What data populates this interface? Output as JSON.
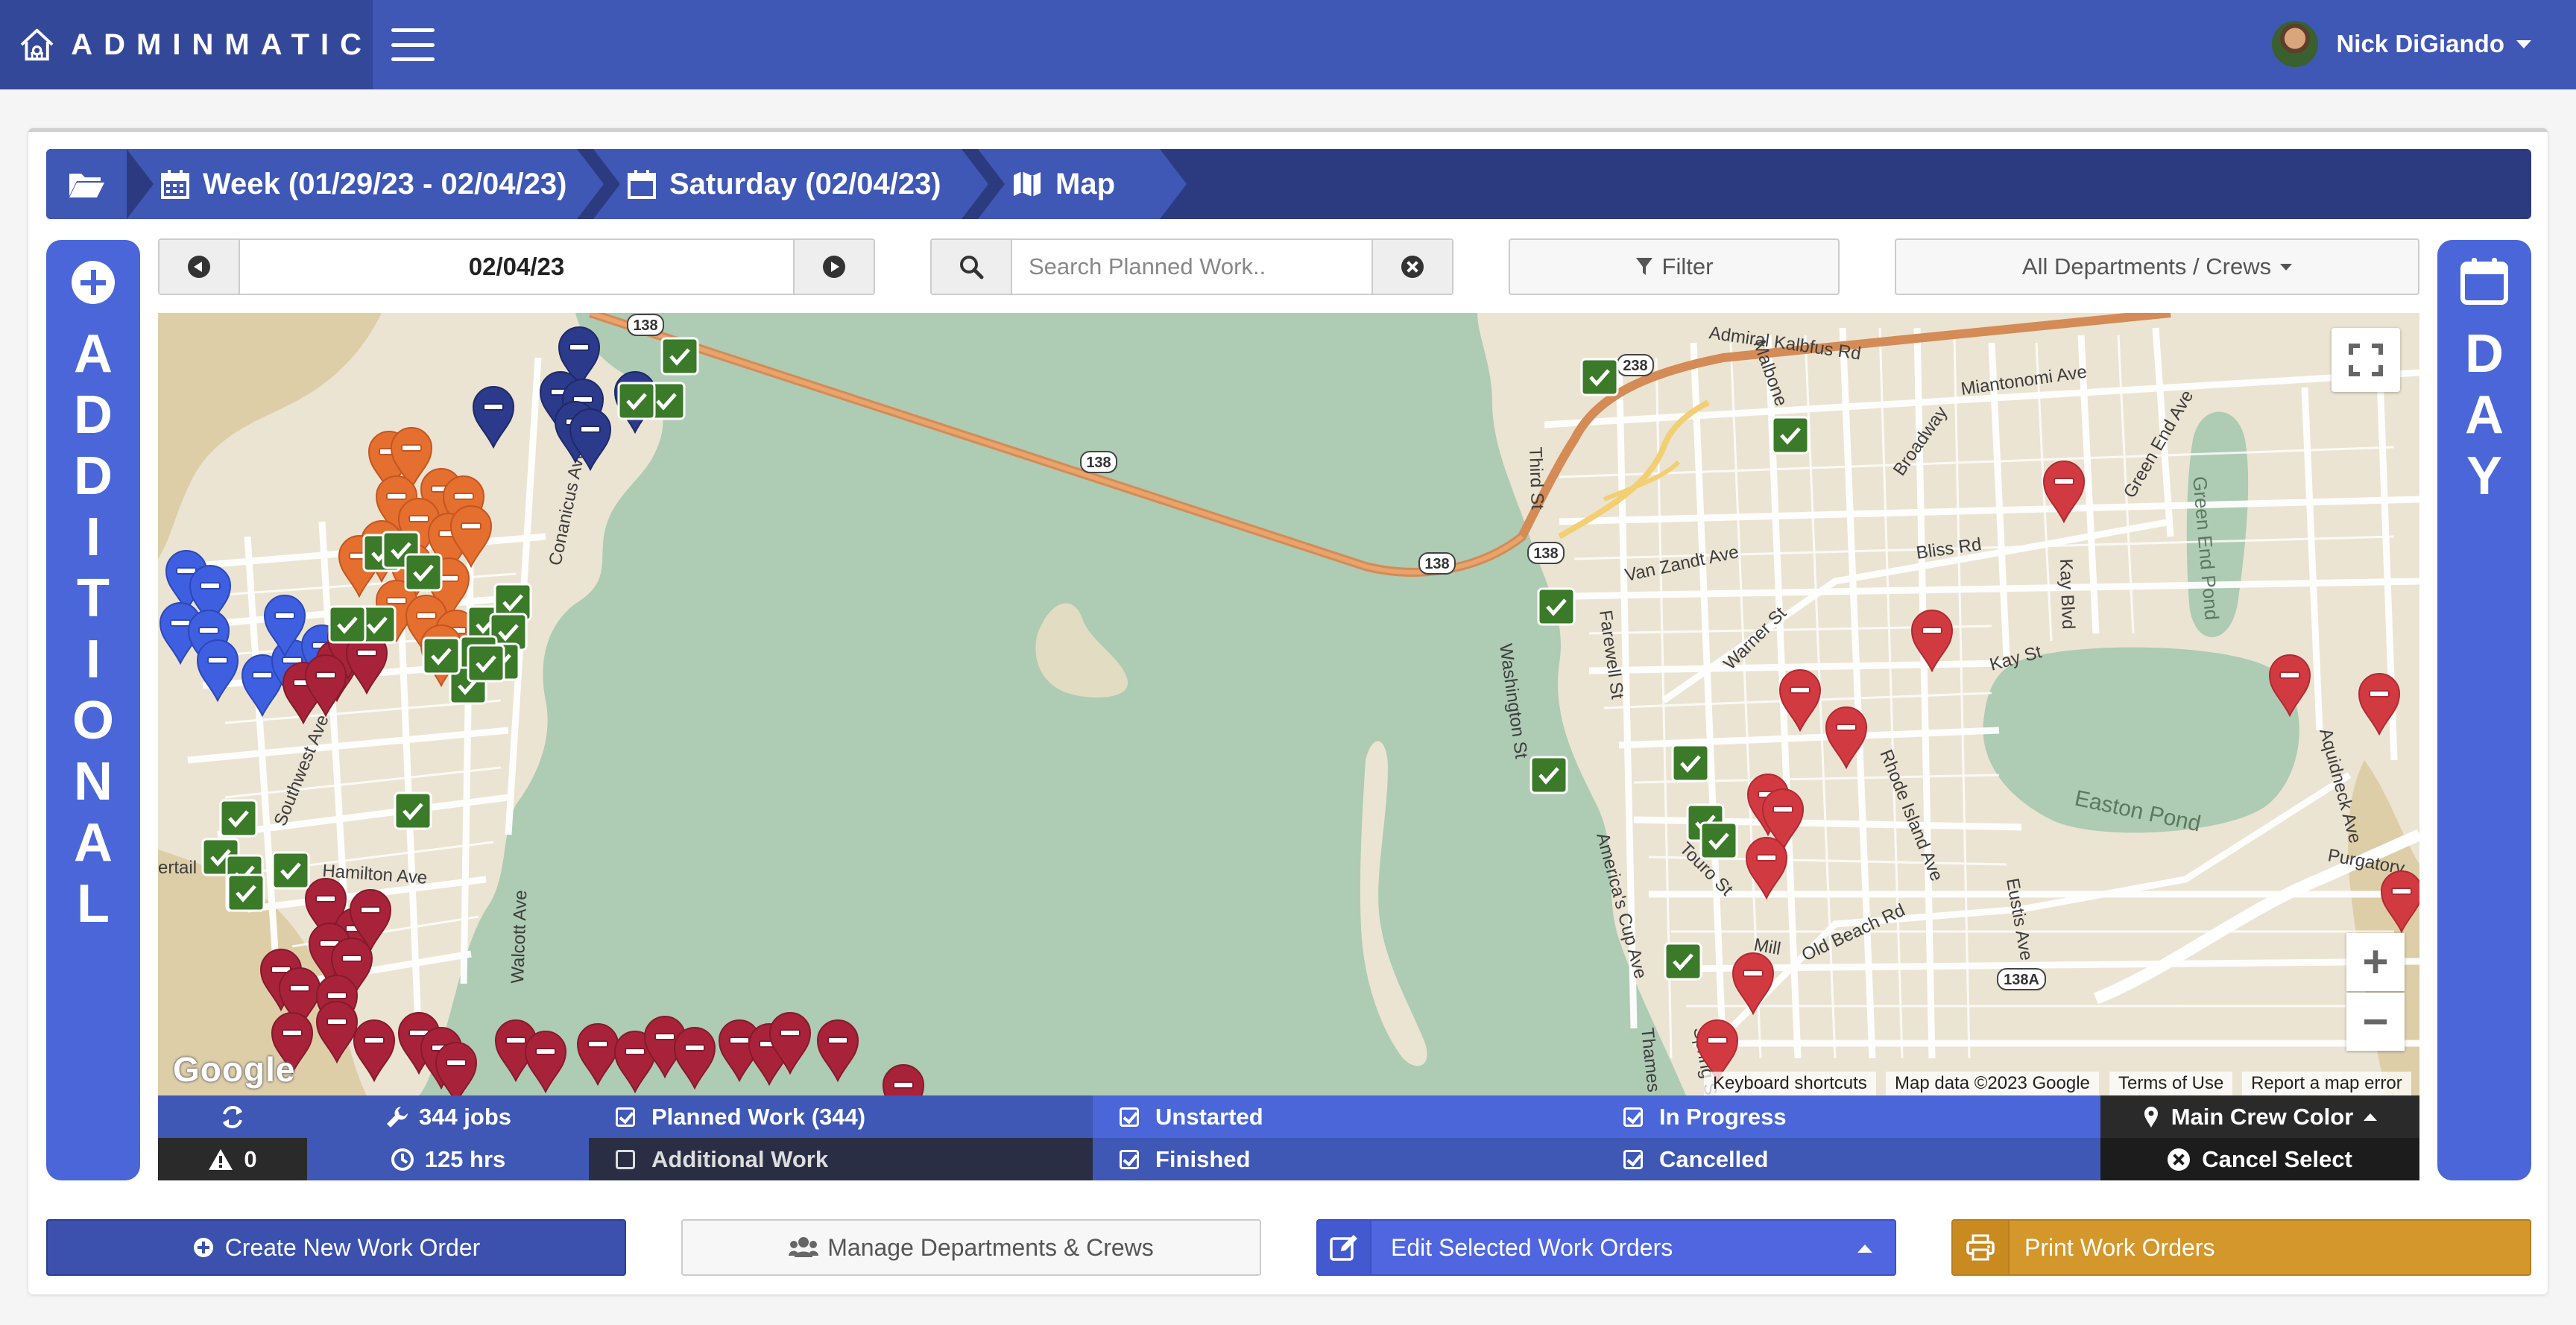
{
  "app": {
    "brand": "ADMINMATIC",
    "user_name": "Nick DiGiando"
  },
  "breadcrumb": {
    "week": "Week (01/29/23 - 02/04/23)",
    "day": "Saturday (02/04/23)",
    "view": "Map"
  },
  "side": {
    "left_label": [
      "A",
      "D",
      "D",
      "I",
      "T",
      "I",
      "O",
      "N",
      "A",
      "L"
    ],
    "right_label": [
      "D",
      "A",
      "Y"
    ]
  },
  "controls": {
    "date": "02/04/23",
    "search_placeholder": "Search Planned Work..",
    "filter_label": "Filter",
    "departments_label": "All Departments / Crews"
  },
  "map": {
    "labels": {
      "road_138_a": "138",
      "road_138_b": "138",
      "road_138_c": "138",
      "road_138_d": "138",
      "road_238": "238",
      "road_138a": "138A",
      "admiral": "Admiral Kalbfus Rd",
      "miantonomi": "Miantonomi Ave",
      "malbone": "Malbone",
      "broadway": "Broadway",
      "green_end_ave": "Green End Ave",
      "green_end_pond": "Green End Pond",
      "third_st": "Third St",
      "bliss": "Bliss Rd",
      "kay_blvd": "Kay Blvd",
      "van_zandt": "Van Zandt Ave",
      "farewell": "Farewell St",
      "warner": "Warner St",
      "washington": "Washington St",
      "kay_st": "Kay St",
      "rhode_island": "Rhode Island Ave",
      "easton_pond": "Easton Pond",
      "aquidneck": "Aquidneck Ave",
      "purgatory": "Purgatory",
      "americas_cup": "America's Cup Ave",
      "touro": "Touro St",
      "eustis": "Eustis Ave",
      "old_beach": "Old Beach Rd",
      "mill": "Mill",
      "spring": "Spring St",
      "thames": "Thames",
      "southwest": "Southwest Ave",
      "hamilton": "Hamilton Ave",
      "walcott": "Walcott Ave",
      "conanicus": "Conanicus Ave",
      "ertail": "ertail R"
    },
    "google": "Google",
    "keyboard_shortcuts": "Keyboard shortcuts",
    "map_data": "Map data ©2023 Google",
    "terms": "Terms of Use",
    "report": "Report a map error",
    "zoom_in": "+",
    "zoom_out": "−"
  },
  "stats": {
    "alerts": "0",
    "jobs": "344 jobs",
    "hours": "125 hrs",
    "filters": [
      {
        "label": "Planned Work (344)",
        "checked": true
      },
      {
        "label": "Additional Work",
        "checked": false
      },
      {
        "label": "Unstarted",
        "checked": true
      },
      {
        "label": "Finished",
        "checked": true
      },
      {
        "label": "In Progress",
        "checked": true
      },
      {
        "label": "Cancelled",
        "checked": true
      }
    ],
    "main_crew_color": "Main Crew Color",
    "cancel_select": "Cancel Select"
  },
  "actions": {
    "create": "Create New Work Order",
    "manage": "Manage Departments & Crews",
    "edit": "Edit Selected Work Orders",
    "print": "Print Work Orders"
  },
  "colors": {
    "nav": "#3f57b5",
    "breadcrumb_dark": "#2c3b80",
    "side_panel": "#4a66d8",
    "pin_green": "#3a7a28",
    "pin_red": "#d23a42",
    "pin_maroon": "#a8233a",
    "pin_orange": "#e46f2f",
    "pin_navy": "#2b3a8a",
    "pin_blue": "#3e5fe0",
    "print": "#d4972b"
  }
}
